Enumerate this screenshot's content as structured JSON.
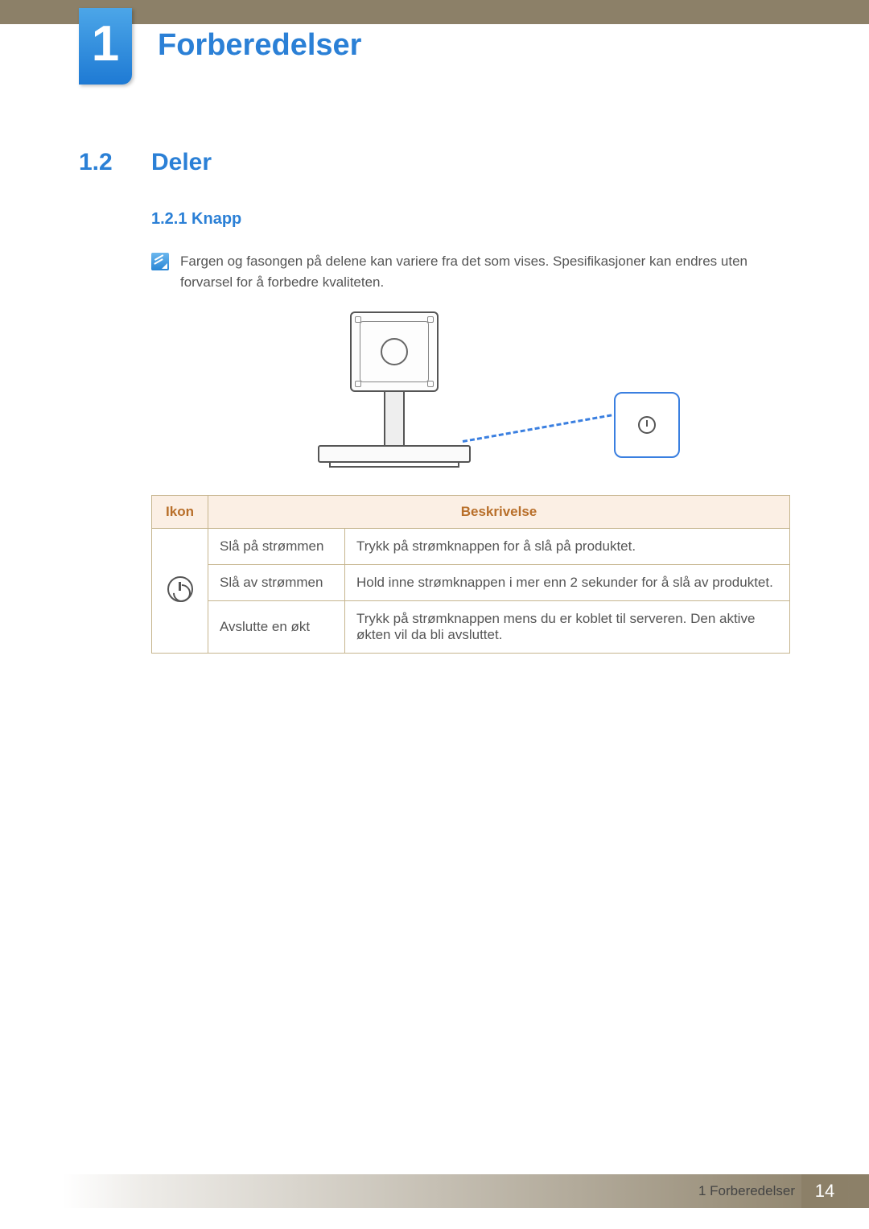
{
  "chapter": {
    "number": "1",
    "title": "Forberedelser"
  },
  "section": {
    "number": "1.2",
    "title": "Deler"
  },
  "subsection": {
    "number": "1.2.1",
    "title": "Knapp",
    "full": "1.2.1   Knapp"
  },
  "note": "Fargen og fasongen på delene kan variere fra det som vises. Spesifikasjoner kan endres uten forvarsel for å forbedre kvaliteten.",
  "table": {
    "headers": {
      "icon": "Ikon",
      "desc": "Beskrivelse"
    },
    "rows": [
      {
        "action": "Slå på strømmen",
        "desc": "Trykk på strømknappen for å slå på produktet."
      },
      {
        "action": "Slå av strømmen",
        "desc": "Hold inne strømknappen i mer enn 2 sekunder for å slå av produktet."
      },
      {
        "action": "Avslutte en økt",
        "desc": "Trykk på strømknappen mens du er koblet til serveren. Den aktive økten vil da bli avsluttet."
      }
    ]
  },
  "footer": {
    "label": "1 Forberedelser",
    "page": "14"
  }
}
